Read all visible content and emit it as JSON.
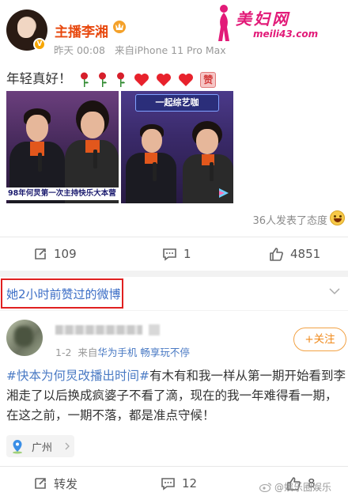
{
  "post1": {
    "username": "主播李湘",
    "time": "昨天 00:08",
    "source": "来自iPhone 11 Pro Max",
    "text": "年轻真好！",
    "image1_caption": "98年何炅第一次主持快乐大本营",
    "image2_banner": "一起综艺咖",
    "reactions": "36人发表了态度",
    "actions": {
      "repost_count": "109",
      "comment_count": "1",
      "like_count": "4851"
    }
  },
  "watermark": {
    "title": "美妇网",
    "url": "meili43.com"
  },
  "liked_section": {
    "title": "她2小时前赞过的微博"
  },
  "post2": {
    "time": "1-2",
    "source_prefix": "来自",
    "source_client": "华为手机 畅享玩不停",
    "follow_label": "+关注",
    "hashtag": "#快本为何炅改播出时间#",
    "text": "有木有和我一样从第一期开始看到李湘走了以后换成疯婆子不看了滴，现在的我一年难得看一期，在这之前，一期不落，都是准点守候！",
    "location": "广州",
    "actions": {
      "repost_label": "转发",
      "comment_count": "12",
      "like_count": "8"
    },
    "site_watermark": "@娱乐圈娱乐"
  },
  "colors": {
    "username": "#e8490f",
    "link": "#4a7ac4",
    "highlight_box": "#e02020",
    "follow": "#f08a1c"
  },
  "icons": [
    "vip-badge-icon",
    "rose-icon",
    "heart-icon",
    "zan-icon",
    "repost-icon",
    "comment-icon",
    "like-icon",
    "chevron-down-icon",
    "location-icon",
    "chevron-right-icon",
    "laugh-emoji-icon"
  ]
}
